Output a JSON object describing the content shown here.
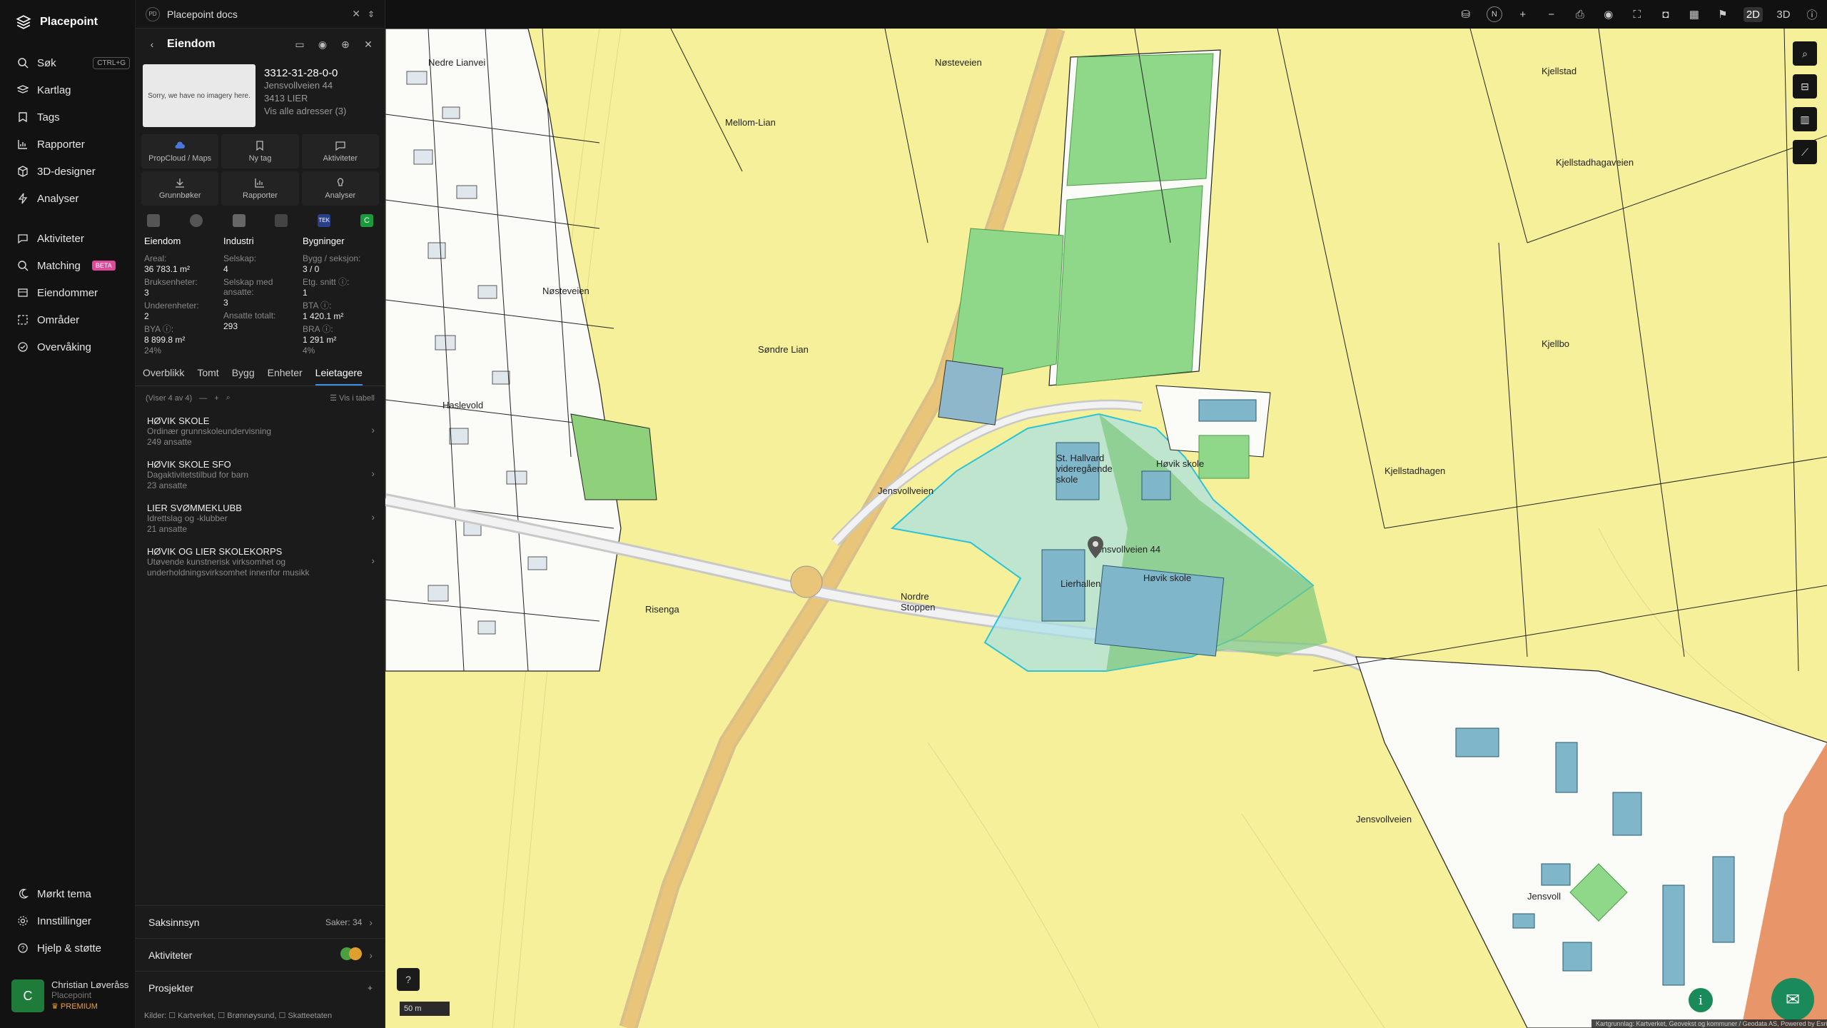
{
  "nav": {
    "brand": "Placepoint",
    "items": [
      {
        "label": "Søk",
        "icon": "search-icon",
        "kbd": "CTRL+G"
      },
      {
        "label": "Kartlag",
        "icon": "layers-icon"
      },
      {
        "label": "Tags",
        "icon": "bookmark-icon"
      },
      {
        "label": "Rapporter",
        "icon": "chart-icon"
      },
      {
        "label": "3D-designer",
        "icon": "cube-icon"
      },
      {
        "label": "Analyser",
        "icon": "bolt-icon"
      },
      {
        "label": "Aktiviteter",
        "icon": "chat-icon"
      },
      {
        "label": "Matching",
        "icon": "match-icon",
        "badge": "BETA"
      },
      {
        "label": "Eiendommer",
        "icon": "list-icon"
      },
      {
        "label": "Områder",
        "icon": "area-icon"
      },
      {
        "label": "Overvåking",
        "icon": "eye-icon"
      },
      {
        "label": "Mørkt tema",
        "icon": "moon-icon"
      },
      {
        "label": "Innstillinger",
        "icon": "gear-icon"
      },
      {
        "label": "Hjelp & støtte",
        "icon": "help-icon"
      }
    ],
    "user": {
      "initial": "C",
      "name": "Christian Løveråss",
      "org": "Placepoint",
      "plan": "PREMIUM"
    }
  },
  "tab": {
    "logo": "PD",
    "title": "Placepoint docs"
  },
  "panel": {
    "header": "Eiendom",
    "property": {
      "no_image": "Sorry, we have no imagery here.",
      "id": "3312-31-28-0-0",
      "address": "Jensvollveien 44",
      "postal": "3413 LIER",
      "all_addresses": "Vis alle adresser (3)"
    },
    "actions": [
      "PropCloud / Maps",
      "Ny tag",
      "Aktiviteter",
      "Grunnbøker",
      "Rapporter",
      "Analyser"
    ],
    "stats": {
      "eiendom": {
        "title": "Eiendom",
        "areal_label": "Areal:",
        "areal": "36 783.1 m²",
        "bruks_label": "Bruksenheter:",
        "bruks": "3",
        "under_label": "Underenheter:",
        "under": "2",
        "bya_label": "BYA ⓘ:",
        "bya": "8 899.8 m²",
        "bya_pct": "24%"
      },
      "industri": {
        "title": "Industri",
        "selskap_label": "Selskap:",
        "selskap": "4",
        "ansatte_sel_label": "Selskap med ansatte:",
        "ansatte_sel": "3",
        "ansatte_label": "Ansatte totalt:",
        "ansatte": "293"
      },
      "bygninger": {
        "title": "Bygninger",
        "bygg_label": "Bygg / seksjon:",
        "bygg": "3 / 0",
        "etg_label": "Etg. snitt ⓘ:",
        "etg": "1",
        "bta_label": "BTA ⓘ:",
        "bta": "1 420.1 m²",
        "bra_label": "BRA ⓘ:",
        "bra": "1 291 m²",
        "bra_pct": "4%"
      }
    },
    "tabs": [
      "Overblikk",
      "Tomt",
      "Bygg",
      "Enheter",
      "Leietagere"
    ],
    "list_info": "(Viser 4 av 4)",
    "table_view": "Vis i tabell",
    "tenants": [
      {
        "name": "HØVIK SKOLE",
        "desc": "Ordinær grunnskoleundervisning",
        "emp": "249 ansatte"
      },
      {
        "name": "HØVIK SKOLE SFO",
        "desc": "Dagaktivitetstilbud for barn",
        "emp": "23 ansatte"
      },
      {
        "name": "LIER SVØMMEKLUBB",
        "desc": "Idrettslag og -klubber",
        "emp": "21 ansatte"
      },
      {
        "name": "HØVIK OG LIER SKOLEKORPS",
        "desc": "Utøvende kunstnerisk virksomhet og underholdningsvirksomhet innenfor musikk",
        "emp": ""
      }
    ],
    "saksinnsyn": "Saksinnsyn",
    "saker": "Saker: 34",
    "aktiviteter": "Aktiviteter",
    "prosjekter": "Prosjekter",
    "sources": "Kilder: ☐ Kartverket, ☐ Brønnøysund, ☐ Skatteetaten"
  },
  "topbar": {
    "north": "N",
    "mode2d": "2D",
    "mode3d": "3D"
  },
  "map": {
    "scale": "50 m",
    "attribution": "Kartgrunnlag: Kartverket, Geovekst og kommuner / Geodata AS, Powered by Esri",
    "labels": [
      "Høvik skole",
      "Høvik skole",
      "St. Hallvard videregående skole",
      "Lierhallen",
      "Jensvollveien 44",
      "Nordre Stoppen",
      "Søndre Lian",
      "Mellom-Lian",
      "Nøsteveien",
      "Jensvollveien",
      "Haslevold",
      "Risenga",
      "Kjellstad",
      "Kjellstadhagen",
      "Kjellbo",
      "Jensvoll",
      "Nedre Lianvei",
      "Jensvollveien",
      "Nøsteveien",
      "Kjellstadhagaveien"
    ]
  }
}
